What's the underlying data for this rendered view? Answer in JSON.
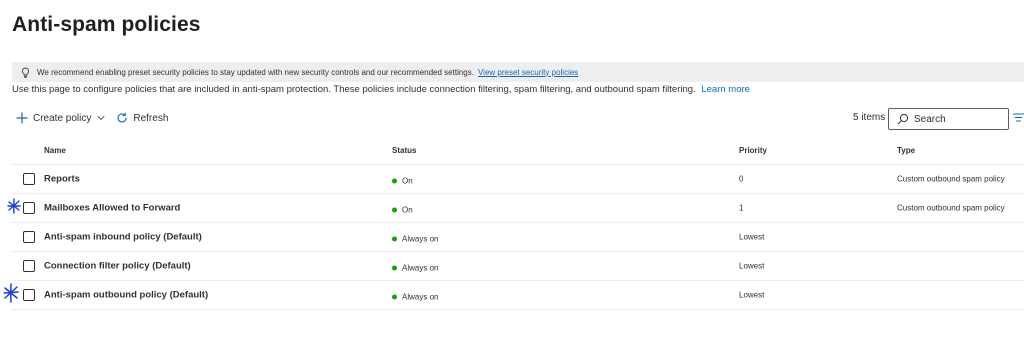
{
  "page": {
    "title": "Anti-spam policies"
  },
  "banner": {
    "text": "We recommend enabling preset security policies to stay updated with new security controls and our recommended settings.",
    "link_text": "View preset security policies"
  },
  "description": {
    "text": "Use this page to configure policies that are included in anti-spam protection. These policies include connection filtering, spam filtering, and outbound spam filtering.",
    "link_text": "Learn more"
  },
  "toolbar": {
    "create_policy_label": "Create policy",
    "refresh_label": "Refresh",
    "items_count": "5 items",
    "search_placeholder": "Search"
  },
  "table": {
    "columns": {
      "name": "Name",
      "status": "Status",
      "priority": "Priority",
      "type": "Type"
    },
    "rows": [
      {
        "name": "Reports",
        "status": "On",
        "priority": "0",
        "type": "Custom outbound spam policy"
      },
      {
        "name": "Mailboxes Allowed to Forward",
        "status": "On",
        "priority": "1",
        "type": "Custom outbound spam policy"
      },
      {
        "name": "Anti-spam inbound policy (Default)",
        "status": "Always on",
        "priority": "Lowest",
        "type": ""
      },
      {
        "name": "Connection filter policy (Default)",
        "status": "Always on",
        "priority": "Lowest",
        "type": ""
      },
      {
        "name": "Anti-spam outbound policy (Default)",
        "status": "Always on",
        "priority": "Lowest",
        "type": ""
      }
    ]
  },
  "colors": {
    "accent": "#0f6cbd",
    "status_on": "#13a10e",
    "annotation": "#1a3de0"
  },
  "icons": {
    "banner": "lightbulb-icon",
    "create": "plus-icon",
    "create_menu": "chevron-down-icon",
    "refresh": "refresh-icon",
    "search": "search-icon",
    "filter": "filter-icon"
  }
}
